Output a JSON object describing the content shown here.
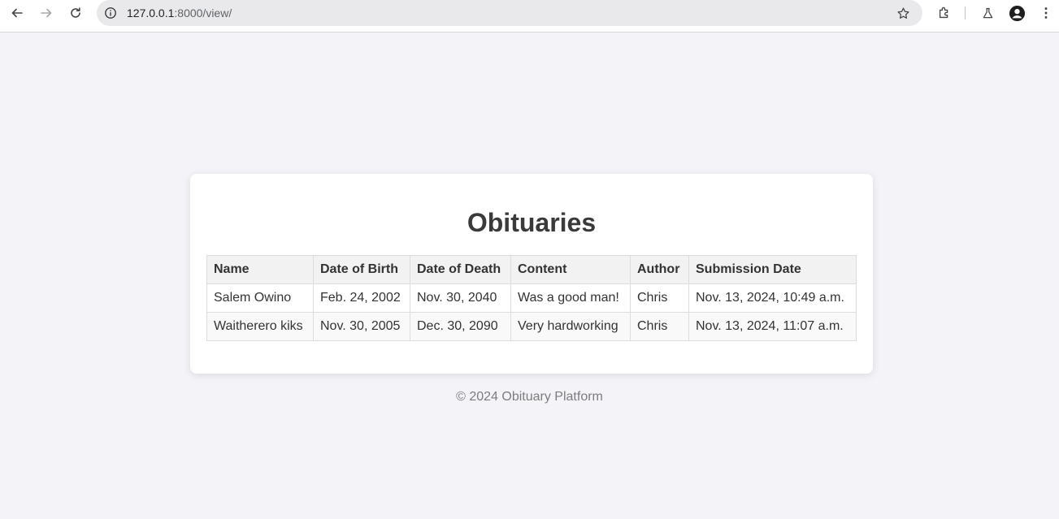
{
  "browser": {
    "url_host": "127.0.0.1",
    "url_rest": ":8000/view/",
    "icons": [
      "back-arrow-icon",
      "forward-arrow-icon",
      "reload-icon",
      "site-info-icon",
      "bookmark-star-icon",
      "extensions-icon",
      "labs-flask-icon",
      "profile-avatar-icon",
      "more-menu-icon"
    ]
  },
  "main": {
    "title": "Obituaries",
    "table": {
      "headers": [
        "Name",
        "Date of Birth",
        "Date of Death",
        "Content",
        "Author",
        "Submission Date"
      ],
      "rows": [
        [
          "Salem Owino",
          "Feb. 24, 2002",
          "Nov. 30, 2040",
          "Was a good man!",
          "Chris",
          "Nov. 13, 2024, 10:49 a.m."
        ],
        [
          "Waitherero kiks",
          "Nov. 30, 2005",
          "Dec. 30, 2090",
          "Very hardworking",
          "Chris",
          "Nov. 13, 2024, 11:07 a.m."
        ]
      ]
    }
  },
  "footer": {
    "text": "© 2024 Obituary Platform"
  },
  "colors": {
    "page_bg": "#f4f3f8",
    "card_bg": "#ffffff",
    "header_bg": "#f2f2f2",
    "title_color": "#3a3a3a"
  }
}
